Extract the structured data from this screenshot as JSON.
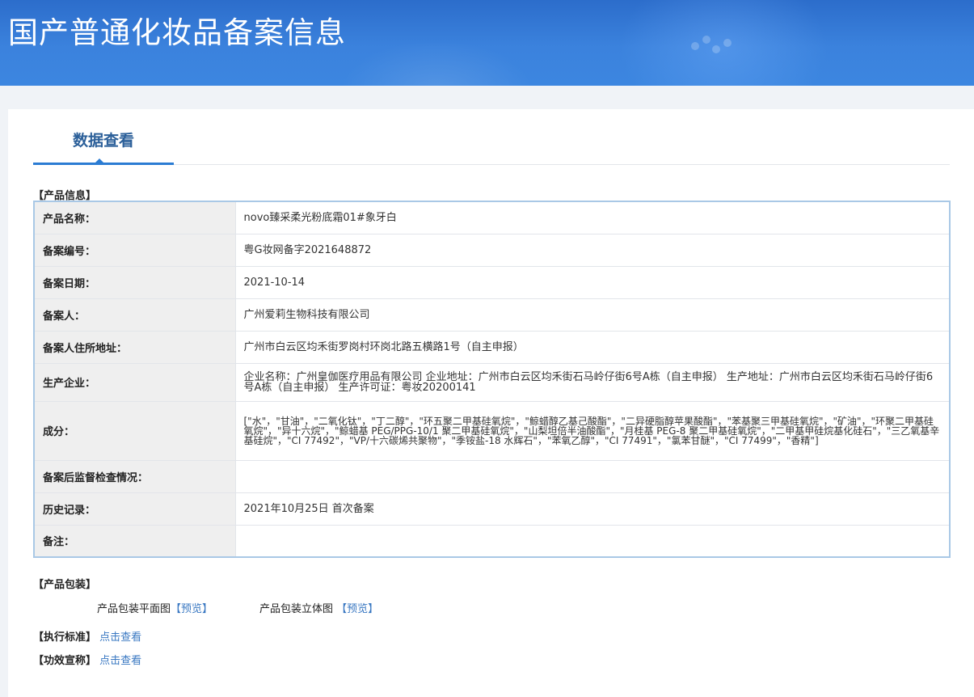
{
  "header": {
    "title": "国产普通化妆品备案信息"
  },
  "tabs": [
    {
      "label": "数据查看"
    }
  ],
  "product_info": {
    "section_title": "【产品信息】",
    "rows": [
      {
        "label": "产品名称：",
        "value": "novo臻采柔光粉底霜01#象牙白"
      },
      {
        "label": "备案编号：",
        "value": "粤G妆网备字2021648872"
      },
      {
        "label": "备案日期：",
        "value": "2021-10-14"
      },
      {
        "label": "备案人：",
        "value": "广州爱莉生物科技有限公司"
      },
      {
        "label": "备案人住所地址：",
        "value": "广州市白云区均禾街罗岗村环岗北路五横路1号（自主申报）"
      },
      {
        "label": "生产企业：",
        "value": "企业名称：广州皇伽医疗用品有限公司 企业地址：广州市白云区均禾街石马岭仔街6号A栋（自主申报） 生产地址：广州市白云区均禾街石马岭仔街6号A栋（自主申报） 生产许可证：粤妆20200141"
      },
      {
        "label": "成分：",
        "value": "[\"水\"，\"甘油\"，\"二氧化钛\"，\"丁二醇\"，\"环五聚二甲基硅氧烷\"，\"鲸蜡醇乙基己酸酯\"，\"二异硬脂醇苹果酸酯\"，\"苯基聚三甲基硅氧烷\"，\"矿油\"，\"环聚二甲基硅氧烷\"，\"异十六烷\"，\"鲸蜡基 PEG/PPG-10/1 聚二甲基硅氧烷\"，\"山梨坦倍半油酸酯\"，\"月桂基 PEG-8 聚二甲基硅氧烷\"，\"二甲基甲硅烷基化硅石\"，\"三乙氧基辛基硅烷\"，\"CI 77492\"，\"VP/十六碳烯共聚物\"，\"季铵盐-18 水辉石\"，\"苯氧乙醇\"，\"CI 77491\"，\"氯苯甘醚\"，\"CI 77499\"，\"香精\"]"
      },
      {
        "label": "备案后监督检查情况：",
        "value": ""
      },
      {
        "label": "历史记录：",
        "value": "2021年10月25日 首次备案"
      },
      {
        "label": "备注：",
        "value": ""
      }
    ]
  },
  "packaging": {
    "section_title": "【产品包装】",
    "flat_label": "产品包装平面图",
    "flat_link": "【预览】",
    "solid_label": "产品包装立体图",
    "solid_link": "【预览】"
  },
  "standard": {
    "label": "【执行标准】",
    "link": "点击查看"
  },
  "efficacy": {
    "label": "【功效宣称】",
    "link": "点击查看"
  }
}
